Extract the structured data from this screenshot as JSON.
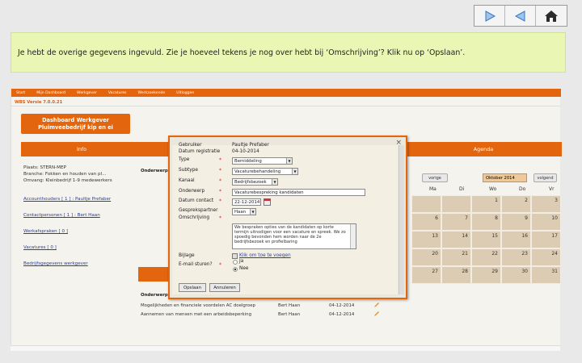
{
  "navigation": {
    "next_icon": "play-right-icon",
    "prev_icon": "play-left-icon",
    "home_icon": "home-icon"
  },
  "instruction": "Je hebt de overige gegevens ingevuld. Zie je hoeveel tekens je nog over hebt bij ‘Omschrijving’? Klik nu op ‘Opslaan’.",
  "app": {
    "nav_items": [
      "Start",
      "Mijn Dashboard",
      "Werkgever",
      "Vacatures",
      "Werkzoekende",
      "Uitloggen"
    ],
    "version": "WBS Versie 7.0.0.21",
    "dashboard_button": [
      "Dashboard Werkgever",
      "Pluimveebedrijf kip en ei"
    ],
    "info": {
      "title": "Info",
      "lines": [
        "Plaats: STERN-MEP",
        "Branche: Fokken en houden van pl...",
        "Omvang: Kleinbedrijf 1-9 medewerkers"
      ],
      "links": [
        "Accounthouders [ 1 ] : Paultje Prefaber",
        "Contactpersonen [ 1 ] : Bert Haan",
        "Werkafspraken [ 0 ]",
        "Vacatures [ 0 ]",
        "Bedrijfsgegevens werkgever"
      ]
    },
    "middle_label_top": "Onderwerp",
    "middle_label_bottom": "Onderwerp",
    "rows": [
      {
        "subject": "Mogelijkheden en financiele voordelen AC doelgroep",
        "contact": "Bert Haan",
        "date": "04-12-2014"
      },
      {
        "subject": "Aannemen van mensen met een arbeidsbeperking",
        "contact": "Bert Haan",
        "date": "04-12-2014"
      }
    ],
    "agenda": {
      "title": "Agenda",
      "prev": "vorige",
      "month": "Oktober 2014",
      "next": "volgend",
      "weekdays": [
        "Ma",
        "Di",
        "Wo",
        "Do",
        "Vr"
      ],
      "weeks": [
        [
          "",
          "",
          "1",
          "2",
          "3"
        ],
        [
          "6",
          "7",
          "8",
          "9",
          "10"
        ],
        [
          "13",
          "14",
          "15",
          "16",
          "17"
        ],
        [
          "20",
          "21",
          "22",
          "23",
          "24"
        ],
        [
          "27",
          "28",
          "29",
          "30",
          "31"
        ]
      ]
    }
  },
  "modal": {
    "close": "×",
    "fields": [
      {
        "label": "Gebruiker",
        "value": "Paultje Prefaber"
      },
      {
        "label": "Datum registratie",
        "value": "04-10-2014"
      },
      {
        "label": "Type",
        "value": "Bemiddeling"
      },
      {
        "label": "Subtype",
        "value": "Vacaturebehandeling"
      },
      {
        "label": "Kanaal",
        "value": "Bedrijfsbezoek"
      },
      {
        "label": "Onderwerp",
        "value": "Vacaturebespreking kandidaten"
      },
      {
        "label": "Datum contact",
        "value": "22-12-2014"
      },
      {
        "label": "Gesprekspartner",
        "value": "Haan"
      },
      {
        "label": "Omschrijving",
        "value": "We bespraken opties van de kandidaten op korte termijn uitnodigen voor een vacature en spreek. We zo spoedig bevonden hem worden naar de 2e bedrijfsbezoek en profielbaring"
      },
      {
        "label": "Bijlage",
        "value": "Klik om toe te voegen"
      },
      {
        "label": "E-mail sturen?",
        "value": ""
      }
    ],
    "required_mark": "*",
    "radio_yes": "Ja",
    "radio_no": "Nee",
    "save": "Opslaan",
    "cancel": "Annuleren"
  }
}
